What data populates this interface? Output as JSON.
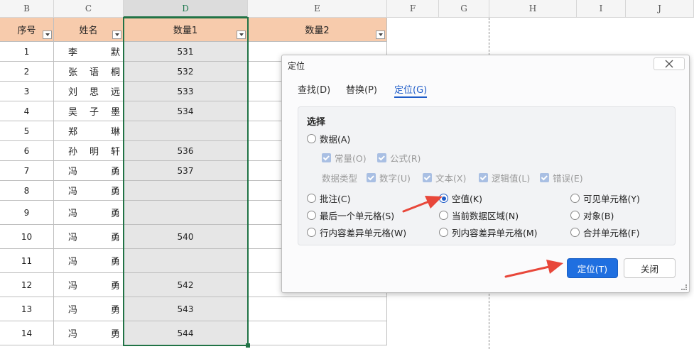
{
  "columns": [
    "B",
    "C",
    "D",
    "E",
    "F",
    "G",
    "H",
    "I",
    "J"
  ],
  "selected_column": "D",
  "table": {
    "headers": [
      "序号",
      "姓名",
      "数量1",
      "数量2"
    ],
    "rows": [
      {
        "no": "1",
        "name": [
          "李",
          "默"
        ],
        "q1": "531"
      },
      {
        "no": "2",
        "name": [
          "张",
          "语",
          "桐"
        ],
        "q1": "532"
      },
      {
        "no": "3",
        "name": [
          "刘",
          "思",
          "远"
        ],
        "q1": "533"
      },
      {
        "no": "4",
        "name": [
          "吴",
          "子",
          "墨"
        ],
        "q1": "534"
      },
      {
        "no": "5",
        "name": [
          "郑",
          "琳"
        ],
        "q1": ""
      },
      {
        "no": "6",
        "name": [
          "孙",
          "明",
          "轩"
        ],
        "q1": "536"
      },
      {
        "no": "7",
        "name": [
          "冯",
          "勇"
        ],
        "q1": "537"
      },
      {
        "no": "8",
        "name": [
          "冯",
          "勇"
        ],
        "q1": ""
      },
      {
        "no": "9",
        "name": [
          "冯",
          "勇"
        ],
        "q1": ""
      },
      {
        "no": "10",
        "name": [
          "冯",
          "勇"
        ],
        "q1": "540"
      },
      {
        "no": "11",
        "name": [
          "冯",
          "勇"
        ],
        "q1": ""
      },
      {
        "no": "12",
        "name": [
          "冯",
          "勇"
        ],
        "q1": "542"
      },
      {
        "no": "13",
        "name": [
          "冯",
          "勇"
        ],
        "q1": "543"
      },
      {
        "no": "14",
        "name": [
          "冯",
          "勇"
        ],
        "q1": "544"
      }
    ]
  },
  "dialog": {
    "title": "定位",
    "tabs": [
      {
        "label": "查找(D)",
        "active": false
      },
      {
        "label": "替换(P)",
        "active": false
      },
      {
        "label": "定位(G)",
        "active": true
      }
    ],
    "section_title": "选择",
    "data_option": "数据(A)",
    "sub_options": [
      {
        "label": "常量(O)",
        "checked": true
      },
      {
        "label": "公式(R)",
        "checked": true
      }
    ],
    "data_type_label": "数据类型",
    "data_types": [
      {
        "label": "数字(U)",
        "checked": true
      },
      {
        "label": "文本(X)",
        "checked": true
      },
      {
        "label": "逻辑值(L)",
        "checked": true
      },
      {
        "label": "错误(E)",
        "checked": true
      }
    ],
    "options": [
      {
        "label": "批注(C)",
        "selected": false
      },
      {
        "label": "空值(K)",
        "selected": true
      },
      {
        "label": "可见单元格(Y)",
        "selected": false
      },
      {
        "label": "最后一个单元格(S)",
        "selected": false
      },
      {
        "label": "当前数据区域(N)",
        "selected": false
      },
      {
        "label": "对象(B)",
        "selected": false
      },
      {
        "label": "行内容差异单元格(W)",
        "selected": false
      },
      {
        "label": "列内容差异单元格(M)",
        "selected": false
      },
      {
        "label": "合并单元格(F)",
        "selected": false
      }
    ],
    "ok_label": "定位(T)",
    "close_label": "关闭"
  },
  "colors": {
    "header_fill": "#f7cbac",
    "selection_border": "#217346",
    "accent": "#1f6fe0",
    "arrow": "#e8473a"
  }
}
